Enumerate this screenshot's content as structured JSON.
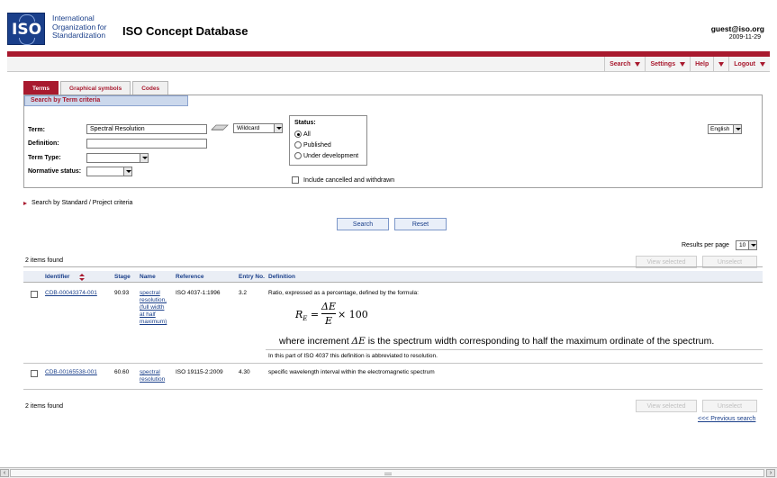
{
  "header": {
    "org_line1": "International",
    "org_line2": "Organization for",
    "org_line3": "Standardization",
    "logo_text": "ISO",
    "db_title": "ISO Concept Database",
    "user_email": "guest@iso.org",
    "date": "2009-11-29"
  },
  "menu": {
    "search": "Search",
    "settings": "Settings",
    "help": "Help",
    "logout": "Logout"
  },
  "tabs": [
    {
      "label": "Terms",
      "active": true
    },
    {
      "label": "Graphical symbols",
      "active": false
    },
    {
      "label": "Codes",
      "active": false
    }
  ],
  "criteria": {
    "title": "Search by Term criteria",
    "language": "English",
    "term_label": "Term:",
    "term_value": "Spectral Resolution",
    "match_mode": "Wildcard",
    "definition_label": "Definition:",
    "definition_value": "",
    "term_type_label": "Term Type:",
    "term_type_value": "",
    "normative_label": "Normative status:",
    "normative_value": "",
    "status_title": "Status:",
    "status_options": [
      "All",
      "Published",
      "Under development"
    ],
    "status_selected": "All",
    "include_cancelled": "Include cancelled and withdrawn"
  },
  "standard_criteria_link": "Search by Standard / Project criteria",
  "buttons": {
    "search": "Search",
    "reset": "Reset",
    "view_selected": "View selected",
    "unselect": "Unselect"
  },
  "results": {
    "found_text": "2 items found",
    "results_per_page_label": "Results per page",
    "results_per_page": "10",
    "columns": [
      "Identifier",
      "Stage",
      "Name",
      "Reference",
      "Entry No.",
      "Definition"
    ],
    "rows": [
      {
        "identifier": "CDB-00043374-001",
        "stage": "90.93",
        "name_lines": [
          "spectral",
          "resolution,",
          "(full width",
          "at half",
          "maximum)"
        ],
        "reference": "ISO 4037-1:1996",
        "entry_no": "3.2",
        "definition": "Ratio, expressed as a percentage, defined by the formula:",
        "formula_lhs": "R",
        "formula_sub": "E",
        "formula_num": "ΔE",
        "formula_den": "E",
        "formula_rhs": "= ",
        "formula_tail": "× 100",
        "explanation_pre": "where increment ",
        "explanation_var": "ΔE",
        "explanation_post": " is the spectrum width corresponding to half the maximum ordinate of the spectrum.",
        "note": "In this part of ISO 4037 this definition is abbreviated to resolution."
      },
      {
        "identifier": "CDB-00165538-001",
        "stage": "60.60",
        "name_lines": [
          "spectral",
          "resolution"
        ],
        "reference": "ISO 19115-2:2009",
        "entry_no": "4.30",
        "definition": "specific wavelength interval within the electromagnetic spectrum"
      }
    ],
    "previous_link": "<<< Previous search"
  }
}
